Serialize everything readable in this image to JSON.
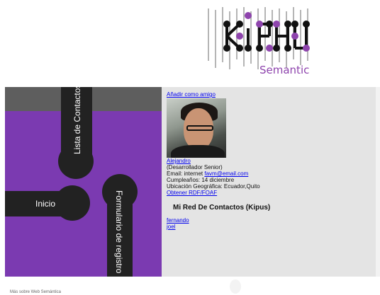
{
  "logo": {
    "text": "Semantic",
    "accent_color": "#8e44ad"
  },
  "menu": {
    "items": [
      {
        "label": "Lista de Contactos"
      },
      {
        "label": "Inicio"
      },
      {
        "label": "Formulario de registro"
      }
    ],
    "background_color": "#7b3ab1",
    "top_bar_color": "#5e5e5e",
    "shape_color": "#222222"
  },
  "profile": {
    "add_friend": "Añadir como amigo",
    "photo_icon": "profile-photo",
    "name": "Alejandro",
    "role": "(Desarrollador Senior)",
    "email_label": "Email: internet ",
    "email": "favm@email.com",
    "birthday": "Cumpleaños: 14 diciembre",
    "location": "Ubicación Geográfica: Ecuador,Quito",
    "rdf_link": "Obtener RDF/FOAF"
  },
  "contacts": {
    "title": "Mi Red De Contactos (Kipus)",
    "items": [
      "fernando",
      "joel"
    ]
  },
  "footer": {
    "text": "Más sobre Web Semántica"
  }
}
